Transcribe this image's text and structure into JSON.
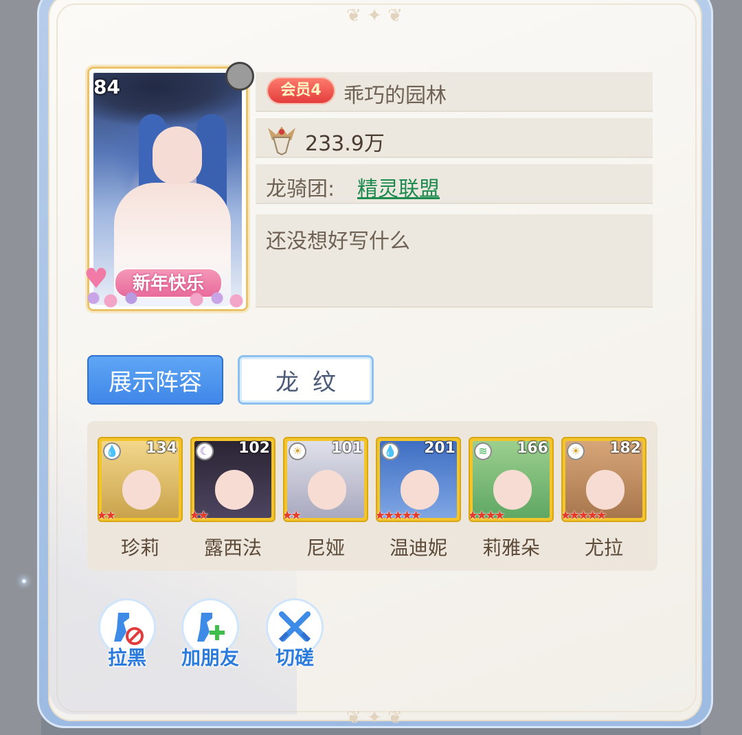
{
  "profile": {
    "level": "84",
    "vip_label": "会员4",
    "name": "乖巧的园林",
    "power": "233.9万",
    "guild_label": "龙骑团:",
    "guild_name": "精灵联盟",
    "signature": "还没想好写什么",
    "frame_banner": "新年快乐"
  },
  "tabs": [
    {
      "label": "展示阵容",
      "active": true
    },
    {
      "label": "龙纹",
      "active": false
    }
  ],
  "lineup": [
    {
      "name": "珍莉",
      "level": "134",
      "element": "water-icon",
      "stars": 2,
      "palette": [
        "#f3d78b",
        "#c9a34c"
      ]
    },
    {
      "name": "露西法",
      "level": "102",
      "element": "moon-icon",
      "stars": 2,
      "palette": [
        "#2a2433",
        "#4d4560"
      ]
    },
    {
      "name": "尼娅",
      "level": "101",
      "element": "sun-icon",
      "stars": 2,
      "palette": [
        "#dfe0ea",
        "#a9a9bf"
      ]
    },
    {
      "name": "温迪妮",
      "level": "201",
      "element": "water-icon",
      "stars": 5,
      "palette": [
        "#3f6fc4",
        "#7fa6e3"
      ]
    },
    {
      "name": "莉雅朵",
      "level": "166",
      "element": "wind-icon",
      "stars": 4,
      "palette": [
        "#9ccf8e",
        "#5fa764"
      ]
    },
    {
      "name": "尤拉",
      "level": "182",
      "element": "sun-icon",
      "stars": 5,
      "palette": [
        "#d6a679",
        "#a8764c"
      ]
    }
  ],
  "actions": [
    {
      "label": "拉黑",
      "icon": "block-user-icon"
    },
    {
      "label": "加朋友",
      "icon": "add-friend-icon"
    },
    {
      "label": "切磋",
      "icon": "crossed-swords-icon"
    }
  ],
  "colors": {
    "accent_blue": "#3f86e8",
    "guild_green": "#1d8a4e",
    "star_red": "#e53b2a",
    "card_gold": "#f3c52a"
  }
}
